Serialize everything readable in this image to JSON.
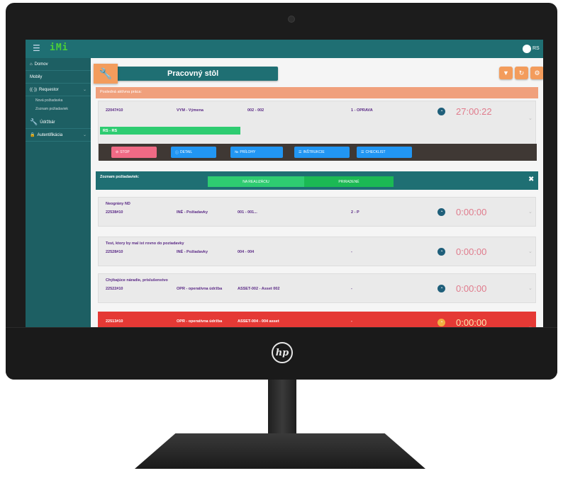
{
  "app": {
    "brand": "iMi",
    "user_initials": "RS"
  },
  "sidebar": {
    "items": [
      {
        "label": "Domov",
        "icon": "home-icon"
      },
      {
        "label": "Mobily",
        "icon": ""
      },
      {
        "label": "Requestor",
        "icon": "broadcast-icon"
      },
      {
        "label": "Nová požiadavka",
        "icon": ""
      },
      {
        "label": "Zoznam požiadaviek",
        "icon": ""
      },
      {
        "label": "Údržbár",
        "icon": "wrench-icon"
      },
      {
        "label": "Autentifikácia",
        "icon": "lock-icon"
      }
    ]
  },
  "header": {
    "title": "Pracovný stôl"
  },
  "active": {
    "bar_label": "Posledná aktívna práca:",
    "id": "22047#10",
    "type": "VYM - Výmena",
    "asset": "002 - 002",
    "priority": "1 - OPRAVA",
    "progress_label": "RS - RS",
    "timer": "27:00:22",
    "buttons": [
      "STOP",
      "DETAIL",
      "PRÍLOHY",
      "INŠTRUKCIE",
      "CHECKLIST"
    ]
  },
  "list": {
    "title": "Zoznam požiadaviek:",
    "tabs": [
      "NA REALIZÁCIU",
      "PRIRADENÉ"
    ],
    "rows": [
      {
        "name": "Neográny ND",
        "id": "22538#10",
        "type": "INÉ - Požiadavky",
        "asset": "001 - 001...",
        "priority": "2 - P",
        "timer": "0:00:00",
        "clock_color": "#1f5f7a",
        "highlight": false
      },
      {
        "name": "Test, ktory by mal ist rovno do poziadavky",
        "id": "22528#10",
        "type": "INÉ - Požiadavky",
        "asset": "004 - 004",
        "priority": "-",
        "timer": "0:00:00",
        "clock_color": "#1f5f7a",
        "highlight": false
      },
      {
        "name": "Chýbajúce náradie, príslušenstvo",
        "id": "22522#10",
        "type": "OPR - operatívna údržba",
        "asset": "ASSET-002 - Asset 002",
        "priority": "-",
        "timer": "0:00:00",
        "clock_color": "#1f5f7a",
        "highlight": false
      },
      {
        "name": "",
        "id": "22513#10",
        "type": "OPR - operatívna údržba",
        "asset": "ASSET-004 - 004 asset",
        "priority": "-",
        "timer": "0:00:00",
        "clock_color": "#f0b042",
        "highlight": true
      }
    ]
  },
  "device": {
    "logo": "hp"
  },
  "colors": {
    "teal": "#1f6f73",
    "orange": "#f39c5c",
    "green": "#2ecc71",
    "blue": "#2196f3",
    "pink": "#f06a85",
    "red": "#e53935"
  }
}
